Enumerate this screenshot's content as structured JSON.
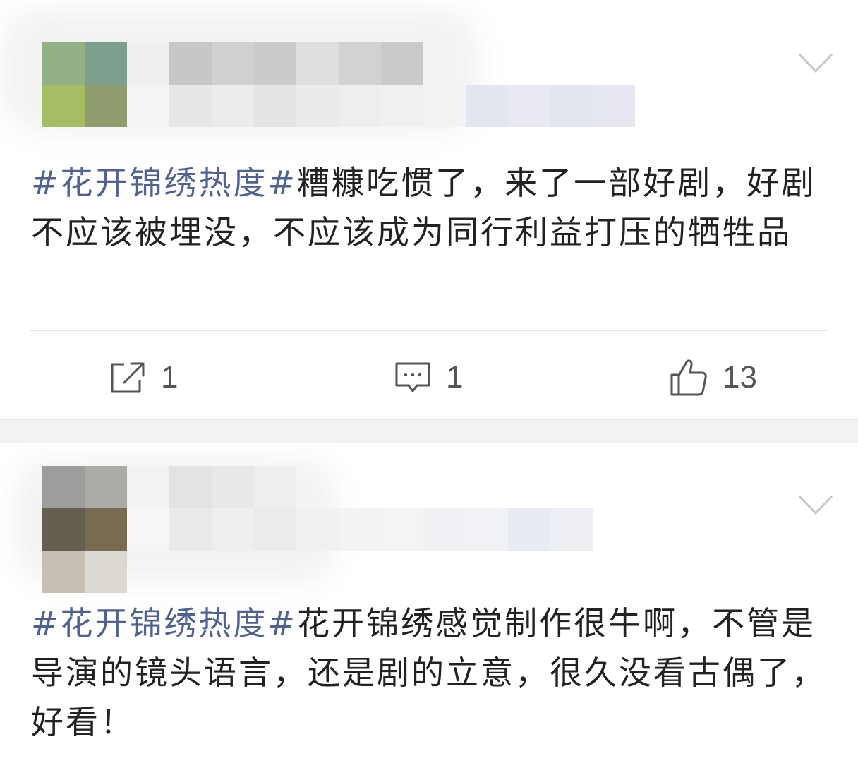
{
  "posts": [
    {
      "text_hashtag": "#花开锦绣热度#",
      "text_body": "糟糠吃惯了，来了一部好剧，好剧不应该被埋没，不应该成为同行利益打压的牺牲品",
      "actions": {
        "repost_count": "1",
        "comment_count": "1",
        "like_count": "13"
      }
    },
    {
      "text_hashtag": "#花开锦绣热度#",
      "text_body": "花开锦绣感觉制作很牛啊，不管是导演的镜头语言，还是剧的立意，很久没看古偶了，好看！"
    }
  ],
  "icons": {
    "menu": "chevron-down-icon",
    "repost": "share-box-icon",
    "comment": "comment-bubble-icon",
    "like": "thumbs-up-icon"
  },
  "colors": {
    "hashtag": "#4f6290",
    "text": "#222222",
    "icon": "#555555",
    "separator_band": "#f2f2f2"
  }
}
